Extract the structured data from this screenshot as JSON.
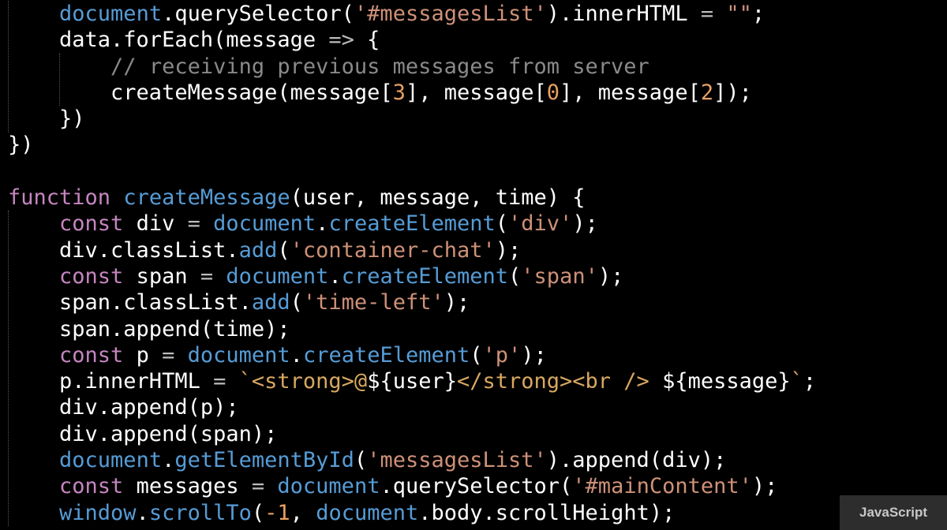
{
  "editor": {
    "language": "JavaScript",
    "colors": {
      "background": "#000000",
      "text": "#ffffff",
      "keyword": "#c586c0",
      "builtin": "#569cd6",
      "string": "#ce9178",
      "number": "#e8a062",
      "comment": "#8a8a8a",
      "operator": "#bcbcbc",
      "tagMarkup": "#d7a860"
    },
    "lines": [
      [
        {
          "t": "    "
        },
        {
          "t": "document",
          "k": "builtin"
        },
        {
          "t": ".querySelector("
        },
        {
          "t": "'#messagesList'",
          "k": "string"
        },
        {
          "t": ").innerHTML "
        },
        {
          "t": "=",
          "k": "operator"
        },
        {
          "t": " "
        },
        {
          "t": "\"\"",
          "k": "string"
        },
        {
          "t": ";"
        }
      ],
      [
        {
          "t": "    data.forEach(message "
        },
        {
          "t": "=>",
          "k": "operator"
        },
        {
          "t": " {"
        }
      ],
      [
        {
          "t": "        "
        },
        {
          "t": "// receiving previous messages from server",
          "k": "comment"
        }
      ],
      [
        {
          "t": "        createMessage(message["
        },
        {
          "t": "3",
          "k": "number"
        },
        {
          "t": "], message["
        },
        {
          "t": "0",
          "k": "number"
        },
        {
          "t": "], message["
        },
        {
          "t": "2",
          "k": "number"
        },
        {
          "t": "]);"
        }
      ],
      [
        {
          "t": "    })"
        }
      ],
      [
        {
          "t": "})"
        }
      ],
      [
        {
          "t": ""
        }
      ],
      [
        {
          "t": "function",
          "k": "keyword"
        },
        {
          "t": " "
        },
        {
          "t": "createMessage",
          "k": "builtin"
        },
        {
          "t": "(user, message, time) {"
        }
      ],
      [
        {
          "t": "    "
        },
        {
          "t": "const",
          "k": "keyword"
        },
        {
          "t": " div "
        },
        {
          "t": "=",
          "k": "operator"
        },
        {
          "t": " "
        },
        {
          "t": "document",
          "k": "builtin"
        },
        {
          "t": "."
        },
        {
          "t": "createElement",
          "k": "builtin"
        },
        {
          "t": "("
        },
        {
          "t": "'div'",
          "k": "string"
        },
        {
          "t": ");"
        }
      ],
      [
        {
          "t": "    div.classList."
        },
        {
          "t": "add",
          "k": "builtin"
        },
        {
          "t": "("
        },
        {
          "t": "'container-chat'",
          "k": "string"
        },
        {
          "t": ");"
        }
      ],
      [
        {
          "t": "    "
        },
        {
          "t": "const",
          "k": "keyword"
        },
        {
          "t": " span "
        },
        {
          "t": "=",
          "k": "operator"
        },
        {
          "t": " "
        },
        {
          "t": "document",
          "k": "builtin"
        },
        {
          "t": "."
        },
        {
          "t": "createElement",
          "k": "builtin"
        },
        {
          "t": "("
        },
        {
          "t": "'span'",
          "k": "string"
        },
        {
          "t": ");"
        }
      ],
      [
        {
          "t": "    span.classList."
        },
        {
          "t": "add",
          "k": "builtin"
        },
        {
          "t": "("
        },
        {
          "t": "'time-left'",
          "k": "string"
        },
        {
          "t": ");"
        }
      ],
      [
        {
          "t": "    span.append(time);"
        }
      ],
      [
        {
          "t": "    "
        },
        {
          "t": "const",
          "k": "keyword"
        },
        {
          "t": " p "
        },
        {
          "t": "=",
          "k": "operator"
        },
        {
          "t": " "
        },
        {
          "t": "document",
          "k": "builtin"
        },
        {
          "t": "."
        },
        {
          "t": "createElement",
          "k": "builtin"
        },
        {
          "t": "("
        },
        {
          "t": "'p'",
          "k": "string"
        },
        {
          "t": ");"
        }
      ],
      [
        {
          "t": "    p.innerHTML "
        },
        {
          "t": "=",
          "k": "operator"
        },
        {
          "t": " "
        },
        {
          "t": "`<strong>@",
          "k": "tagMarkup"
        },
        {
          "t": "${user}"
        },
        {
          "t": "</strong><br />",
          "k": "tagMarkup"
        },
        {
          "t": " ${message}"
        },
        {
          "t": "`",
          "k": "tagMarkup"
        },
        {
          "t": ";"
        }
      ],
      [
        {
          "t": "    div.append(p);"
        }
      ],
      [
        {
          "t": "    div.append(span);"
        }
      ],
      [
        {
          "t": "    "
        },
        {
          "t": "document",
          "k": "builtin"
        },
        {
          "t": "."
        },
        {
          "t": "getElementById",
          "k": "builtin"
        },
        {
          "t": "("
        },
        {
          "t": "'messagesList'",
          "k": "string"
        },
        {
          "t": ").append(div);"
        }
      ],
      [
        {
          "t": "    "
        },
        {
          "t": "const",
          "k": "keyword"
        },
        {
          "t": " messages "
        },
        {
          "t": "=",
          "k": "operator"
        },
        {
          "t": " "
        },
        {
          "t": "document",
          "k": "builtin"
        },
        {
          "t": ".querySelector("
        },
        {
          "t": "'#mainContent'",
          "k": "string"
        },
        {
          "t": ");"
        }
      ],
      [
        {
          "t": "    "
        },
        {
          "t": "window",
          "k": "builtin"
        },
        {
          "t": "."
        },
        {
          "t": "scrollTo",
          "k": "builtin"
        },
        {
          "t": "("
        },
        {
          "t": "-1",
          "k": "number"
        },
        {
          "t": ", "
        },
        {
          "t": "document",
          "k": "builtin"
        },
        {
          "t": ".body.scrollHeight);"
        }
      ]
    ]
  }
}
